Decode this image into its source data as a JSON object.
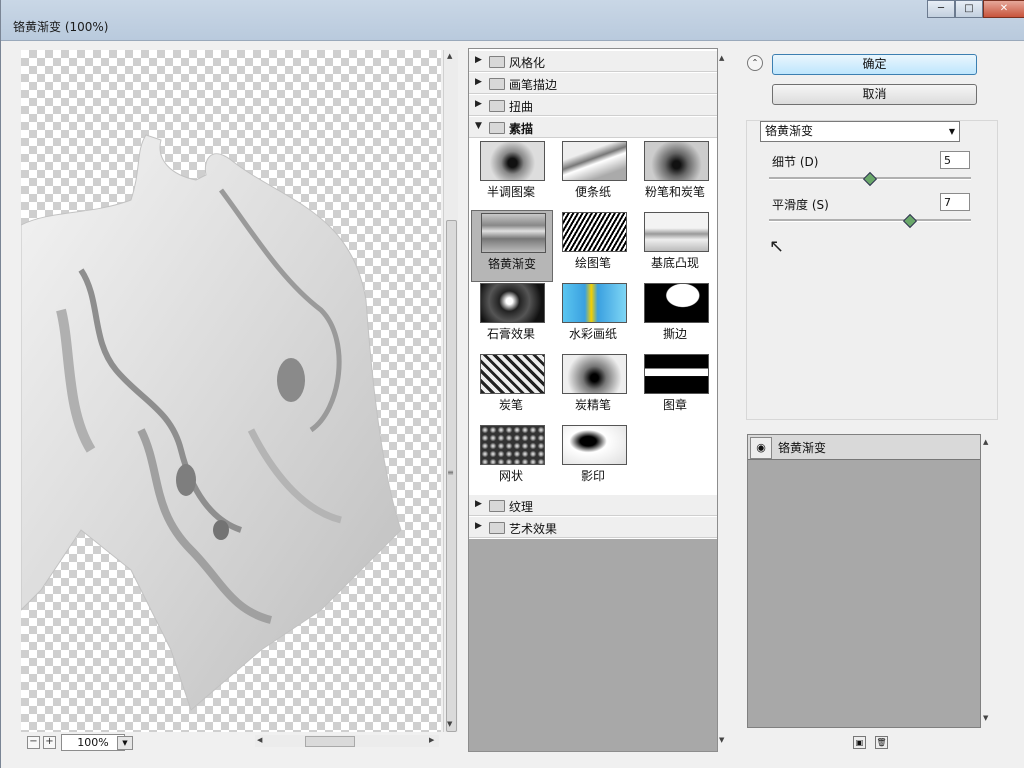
{
  "window": {
    "title": "铬黄渐变 (100%)"
  },
  "preview": {
    "zoom": "100%"
  },
  "filter_tree": {
    "categories_top": [
      {
        "label": "风格化"
      },
      {
        "label": "画笔描边"
      },
      {
        "label": "扭曲"
      },
      {
        "label": "素描",
        "expanded": true
      }
    ],
    "sketch_filters": [
      {
        "label": "半调图案",
        "icon": "halftone-thumb"
      },
      {
        "label": "便条纸",
        "icon": "notepaper-thumb"
      },
      {
        "label": "粉笔和炭笔",
        "icon": "chalk-charcoal-thumb"
      },
      {
        "label": "铬黄渐变",
        "icon": "chrome-thumb",
        "selected": true
      },
      {
        "label": "绘图笔",
        "icon": "graphic-pen-thumb"
      },
      {
        "label": "基底凸现",
        "icon": "bas-relief-thumb"
      },
      {
        "label": "石膏效果",
        "icon": "plaster-thumb"
      },
      {
        "label": "水彩画纸",
        "icon": "water-paper-thumb"
      },
      {
        "label": "撕边",
        "icon": "torn-edges-thumb"
      },
      {
        "label": "炭笔",
        "icon": "charcoal-thumb"
      },
      {
        "label": "炭精笔",
        "icon": "conte-crayon-thumb"
      },
      {
        "label": "图章",
        "icon": "stamp-thumb"
      },
      {
        "label": "网状",
        "icon": "reticulation-thumb"
      },
      {
        "label": "影印",
        "icon": "photocopy-thumb"
      }
    ],
    "categories_bottom": [
      {
        "label": "纹理"
      },
      {
        "label": "艺术效果"
      }
    ]
  },
  "actions": {
    "ok": "确定",
    "cancel": "取消"
  },
  "settings": {
    "filter_select": "铬黄渐变",
    "detail": {
      "label": "细节 (D)",
      "value": "5",
      "level": 0.5
    },
    "smoothness": {
      "label": "平滑度 (S)",
      "value": "7",
      "level": 0.7
    }
  },
  "effect_layers": [
    {
      "name": "铬黄渐变",
      "visible": true
    }
  ]
}
